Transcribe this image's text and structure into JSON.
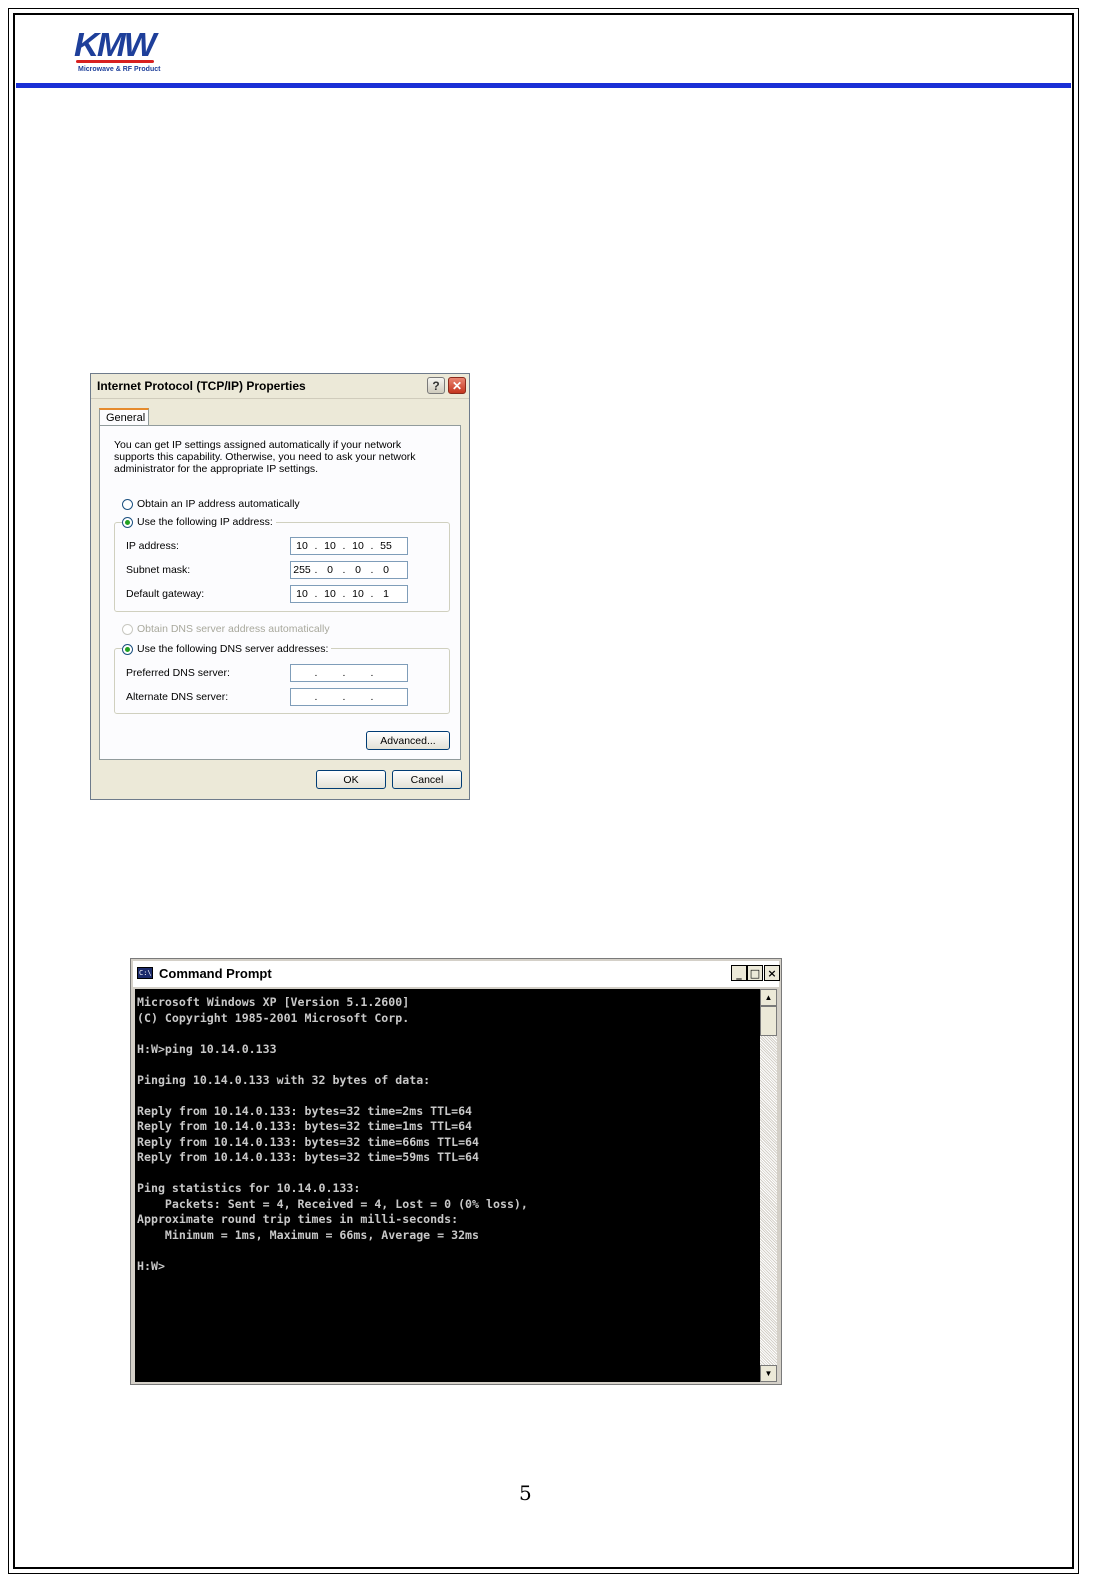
{
  "header": {
    "logo_text": "KMW",
    "logo_tagline": "Microwave & RF Product",
    "brand_color": "#1a2fd6"
  },
  "tcpip_dialog": {
    "title": "Internet Protocol (TCP/IP) Properties",
    "help_label": "?",
    "close_label": "✕",
    "tab_label": "General",
    "intro": "You can get IP settings assigned automatically if your network supports this capability. Otherwise, you need to ask your network administrator for the appropriate IP settings.",
    "radio_auto_ip": "Obtain an IP address automatically",
    "radio_manual_ip": "Use the following IP address:",
    "ip_label": "IP address:",
    "ip_value": [
      "10",
      "10",
      "10",
      "55"
    ],
    "mask_label": "Subnet mask:",
    "mask_value": [
      "255",
      "0",
      "0",
      "0"
    ],
    "gateway_label": "Default gateway:",
    "gateway_value": [
      "10",
      "10",
      "10",
      "1"
    ],
    "radio_auto_dns": "Obtain DNS server address automatically",
    "radio_manual_dns": "Use the following DNS server addresses:",
    "preferred_dns_label": "Preferred DNS server:",
    "alternate_dns_label": "Alternate DNS server:",
    "advanced_button": "Advanced...",
    "ok_button": "OK",
    "cancel_button": "Cancel",
    "selected_ip_mode": "manual",
    "selected_dns_mode": "manual"
  },
  "command_prompt": {
    "title": "Command Prompt",
    "icon_text": "C:\\",
    "minimize_label": "_",
    "maximize_label": "□",
    "close_label": "×",
    "output": "Microsoft Windows XP [Version 5.1.2600]\n(C) Copyright 1985-2001 Microsoft Corp.\n\nH:W>ping 10.14.0.133\n\nPinging 10.14.0.133 with 32 bytes of data:\n\nReply from 10.14.0.133: bytes=32 time=2ms TTL=64\nReply from 10.14.0.133: bytes=32 time=1ms TTL=64\nReply from 10.14.0.133: bytes=32 time=66ms TTL=64\nReply from 10.14.0.133: bytes=32 time=59ms TTL=64\n\nPing statistics for 10.14.0.133:\n    Packets: Sent = 4, Received = 4, Lost = 0 (0% loss),\nApproximate round trip times in milli-seconds:\n    Minimum = 1ms, Maximum = 66ms, Average = 32ms\n\nH:W>"
  },
  "footer": {
    "page_number": "5"
  }
}
